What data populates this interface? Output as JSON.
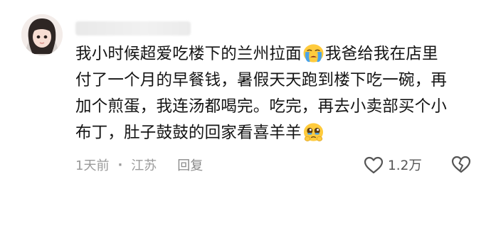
{
  "comment": {
    "lines": [
      {
        "text": "我小时候超爱吃楼下的兰州拉面",
        "emoji": "crying-face",
        "after": "我爸给我在店里"
      },
      {
        "text": "付了一个月的早餐钱，暑假天天跑到楼下吃一碗，再"
      },
      {
        "text": "加个煎蛋，我连汤都喝完。吃完，再去小卖部买个小"
      },
      {
        "text": "布丁，肚子鼓鼓的回家看喜羊羊",
        "emoji": "pleading-face"
      }
    ],
    "time": "1天前",
    "location": "江苏",
    "separator": "·",
    "reply_label": "回复",
    "like_count": "1.2万"
  },
  "icons": {
    "like": "heart-outline-icon",
    "dislike": "broken-heart-icon"
  },
  "colors": {
    "text": "#141414",
    "meta": "#9a9a9a",
    "emoji_yellow": "#FFCB3D",
    "tear_blue": "#4AA3E8"
  }
}
